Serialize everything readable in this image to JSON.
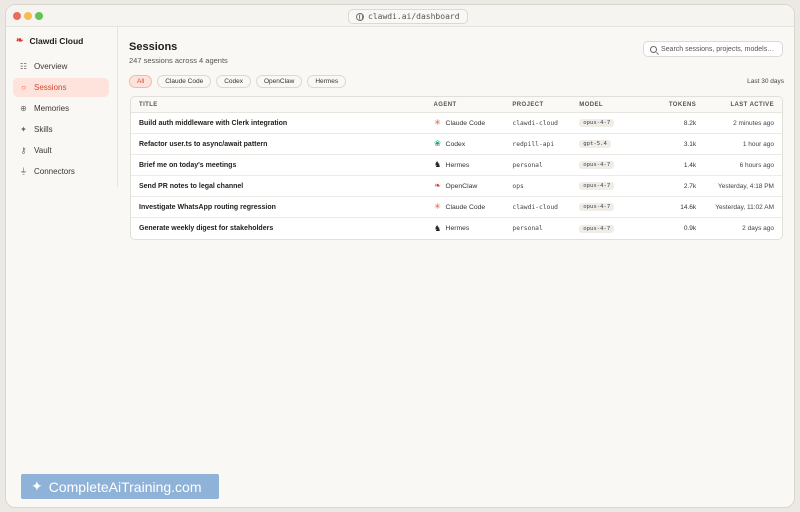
{
  "browser": {
    "url": "clawdi.ai/dashboard"
  },
  "sidebar": {
    "brand": "Clawdi Cloud",
    "items": [
      {
        "label": "Overview",
        "icon": "bar-chart-icon"
      },
      {
        "label": "Sessions",
        "icon": "chat-bubble-icon",
        "active": true
      },
      {
        "label": "Memories",
        "icon": "brain-icon"
      },
      {
        "label": "Skills",
        "icon": "sparkle-icon"
      },
      {
        "label": "Vault",
        "icon": "key-icon"
      },
      {
        "label": "Connectors",
        "icon": "plug-icon"
      }
    ]
  },
  "header": {
    "title": "Sessions",
    "subtitle": "247 sessions across 4 agents",
    "search_placeholder": "Search sessions, projects, models…"
  },
  "filters": {
    "chips": [
      "All",
      "Claude Code",
      "Codex",
      "OpenClaw",
      "Hermes"
    ],
    "active": "All",
    "range": "Last 30 days"
  },
  "table": {
    "columns": [
      "TITLE",
      "AGENT",
      "PROJECT",
      "MODEL",
      "TOKENS",
      "LAST ACTIVE"
    ],
    "rows": [
      {
        "title": "Build auth middleware with Clerk integration",
        "agent": "Claude Code",
        "project": "clawdi-cloud",
        "model": "opus-4-7",
        "tokens": "8.2k",
        "last_active": "2 minutes ago"
      },
      {
        "title": "Refactor user.ts to async/await pattern",
        "agent": "Codex",
        "project": "redpill-api",
        "model": "gpt-5.4",
        "tokens": "3.1k",
        "last_active": "1 hour ago"
      },
      {
        "title": "Brief me on today's meetings",
        "agent": "Hermes",
        "project": "personal",
        "model": "opus-4-7",
        "tokens": "1.4k",
        "last_active": "6 hours ago"
      },
      {
        "title": "Send PR notes to legal channel",
        "agent": "OpenClaw",
        "project": "ops",
        "model": "opus-4-7",
        "tokens": "2.7k",
        "last_active": "Yesterday, 4:18 PM"
      },
      {
        "title": "Investigate WhatsApp routing regression",
        "agent": "Claude Code",
        "project": "clawdi-cloud",
        "model": "opus-4-7",
        "tokens": "14.6k",
        "last_active": "Yesterday, 11:02 AM"
      },
      {
        "title": "Generate weekly digest for stakeholders",
        "agent": "Hermes",
        "project": "personal",
        "model": "opus-4-7",
        "tokens": "0.9k",
        "last_active": "2 days ago"
      }
    ]
  },
  "watermark": {
    "text": "CompleteAiTraining.com"
  },
  "colors": {
    "accent": "#d8472f",
    "accent_bg": "#fde3dc",
    "claude": "#d9573b",
    "codex": "#1aa37a",
    "openclaw": "#d9352a"
  }
}
